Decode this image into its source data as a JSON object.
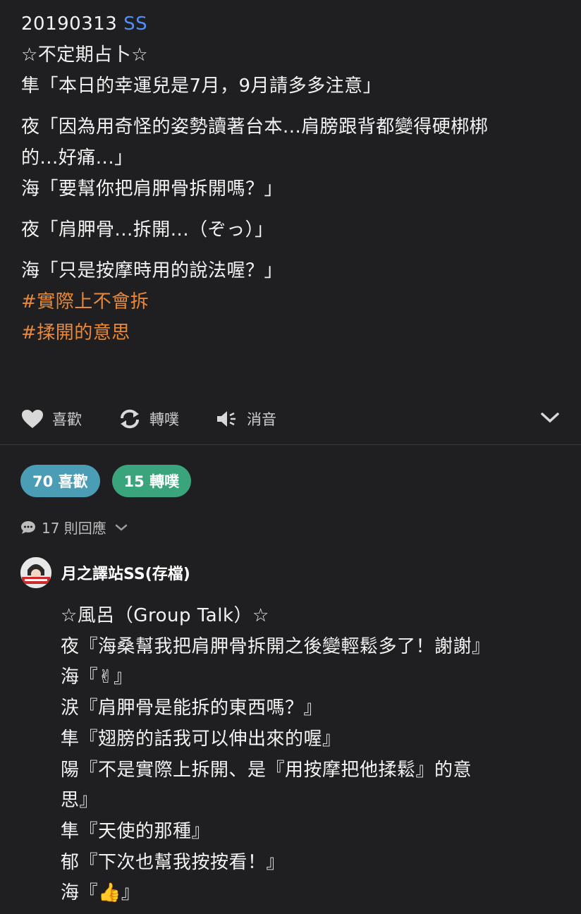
{
  "post": {
    "date": "20190313",
    "ss_label": "SS",
    "lines": [
      "☆不定期占卜☆",
      "隼「本日的幸運兒是7月，9月請多多注意」",
      "",
      "夜「因為用奇怪的姿勢讀著台本...肩膀跟背都變得硬梆梆",
      "的...好痛...」",
      "海「要幫你把肩胛骨拆開嗎？」",
      "",
      "夜「肩胛骨...拆開...（ぞっ）」",
      "",
      "海「只是按摩時用的說法喔？」"
    ],
    "tags": [
      "#實際上不會拆",
      "#揉開的意思"
    ]
  },
  "actions": {
    "like_label": "喜歡",
    "reblog_label": "轉噗",
    "mute_label": "消音"
  },
  "stats": {
    "likes_label": "70 喜歡",
    "reblogs_label": "15 轉噗",
    "replies_label": "17 則回應"
  },
  "reply": {
    "author": "月之譯站SS(存檔)",
    "lines": [
      "☆風呂（Group Talk）☆",
      "夜『海桑幫我把肩胛骨拆開之後變輕鬆多了！謝謝』",
      "海『✌』",
      "涙『肩胛骨是能拆的東西嗎？』",
      "隼『翅膀的話我可以伸出來的喔』",
      "陽『不是實際上拆開、是『用按摩把他揉鬆』的意",
      "思』",
      "隼『天使的那種』",
      "郁『下次也幫我按按看！』",
      "海『👍』"
    ]
  },
  "colors": {
    "background": "#1f1f21",
    "link_blue": "#4f8ff7",
    "tag_orange": "#e8893a",
    "like_pill": "#4b9cb5",
    "reblog_pill": "#3aa57d"
  }
}
